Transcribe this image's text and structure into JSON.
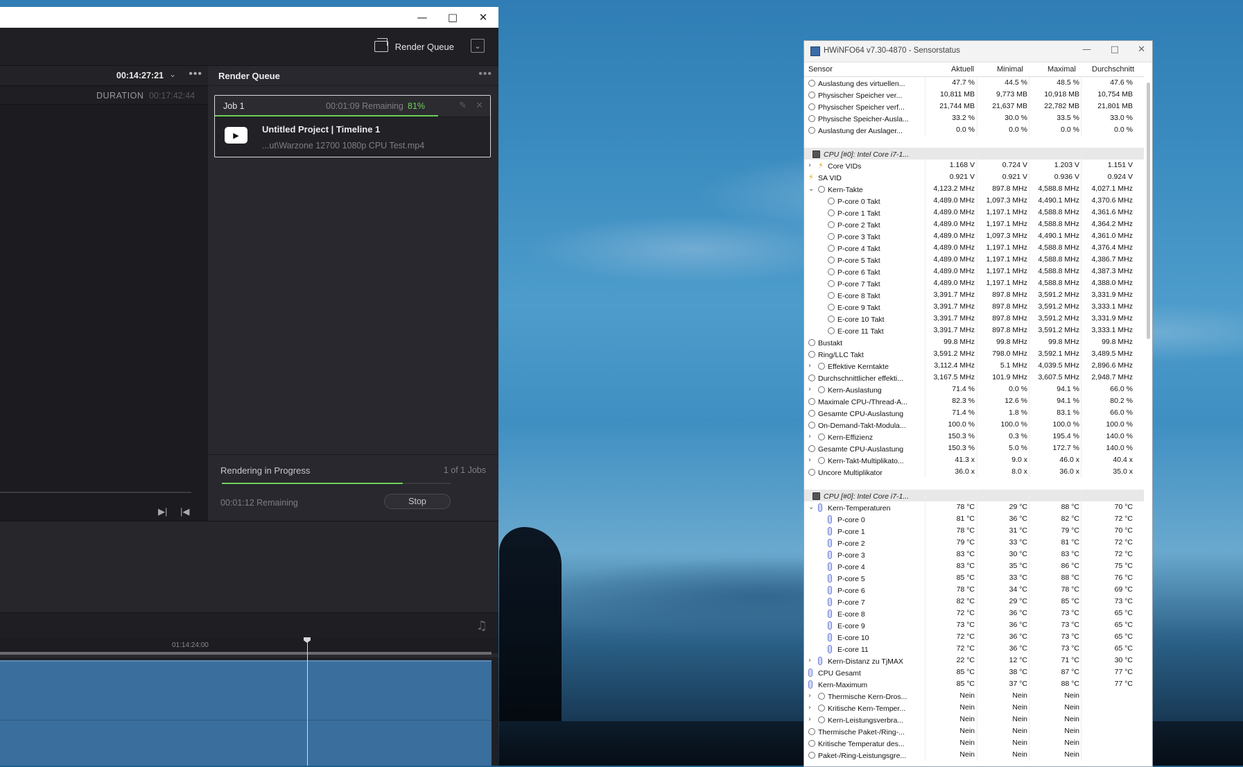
{
  "resolve": {
    "topbar": {
      "render_queue_label": "Render Queue"
    },
    "left_panel": {
      "timecode": "00:14:27:21",
      "duration_label": "DURATION",
      "duration_value": "00:17:42:44"
    },
    "render_queue": {
      "title": "Render Queue",
      "job": {
        "name": "Job 1",
        "remaining": "00:01:09 Remaining",
        "percent": "81%",
        "progress_fraction": 0.81,
        "project": "Untitled Project | Timeline 1",
        "file": "...ut\\Warzone 12700 1080p CPU Test.mp4"
      },
      "footer": {
        "status": "Rendering in Progress",
        "jobs_count": "1 of 1 Jobs",
        "remaining": "00:01:12 Remaining",
        "progress_fraction": 0.79,
        "stop_label": "Stop"
      }
    },
    "timeline": {
      "ruler_timecode": "01:14:24:00"
    }
  },
  "hwinfo": {
    "title": "HWiNFO64 v7.30-4870 - Sensorstatus",
    "columns": [
      "Sensor",
      "Aktuell",
      "Minimal",
      "Maximal",
      "Durchschnitt"
    ],
    "rows": [
      {
        "level": 1,
        "icon": "circle",
        "name": "Auslastung des virtuellen...",
        "v": [
          "47.7 %",
          "44.5 %",
          "48.5 %",
          "47.6 %"
        ]
      },
      {
        "level": 1,
        "icon": "circle",
        "name": "Physischer Speicher ver...",
        "v": [
          "10,811 MB",
          "9,773 MB",
          "10,918 MB",
          "10,754 MB"
        ]
      },
      {
        "level": 1,
        "icon": "circle",
        "name": "Physischer Speicher verf...",
        "v": [
          "21,744 MB",
          "21,637 MB",
          "22,782 MB",
          "21,801 MB"
        ]
      },
      {
        "level": 1,
        "icon": "circle",
        "name": "Physische Speicher-Ausla...",
        "v": [
          "33.2 %",
          "30.0 %",
          "33.5 %",
          "33.0 %"
        ]
      },
      {
        "level": 1,
        "icon": "circle",
        "name": "Auslastung der Auslager...",
        "v": [
          "0.0 %",
          "0.0 %",
          "0.0 %",
          "0.0 %"
        ]
      },
      {
        "blank": true
      },
      {
        "group": true,
        "expand": "open",
        "icon": "chip",
        "name": "CPU [#0]: Intel Core i7-1..."
      },
      {
        "level": 2,
        "expand": "closed",
        "icon": "bolt",
        "name": "Core VIDs",
        "v": [
          "1.168 V",
          "0.724 V",
          "1.203 V",
          "1.151 V"
        ]
      },
      {
        "level": 1,
        "icon": "bolt",
        "name": "SA VID",
        "v": [
          "0.921 V",
          "0.921 V",
          "0.936 V",
          "0.924 V"
        ]
      },
      {
        "level": 2,
        "expand": "open",
        "icon": "circle",
        "name": "Kern-Takte",
        "v": [
          "4,123.2 MHz",
          "897.8 MHz",
          "4,588.8 MHz",
          "4,027.1 MHz"
        ]
      },
      {
        "level": 3,
        "icon": "circle",
        "name": "P-core 0 Takt",
        "v": [
          "4,489.0 MHz",
          "1,097.3 MHz",
          "4,490.1 MHz",
          "4,370.6 MHz"
        ]
      },
      {
        "level": 3,
        "icon": "circle",
        "name": "P-core 1 Takt",
        "v": [
          "4,489.0 MHz",
          "1,197.1 MHz",
          "4,588.8 MHz",
          "4,361.6 MHz"
        ]
      },
      {
        "level": 3,
        "icon": "circle",
        "name": "P-core 2 Takt",
        "v": [
          "4,489.0 MHz",
          "1,197.1 MHz",
          "4,588.8 MHz",
          "4,364.2 MHz"
        ]
      },
      {
        "level": 3,
        "icon": "circle",
        "name": "P-core 3 Takt",
        "v": [
          "4,489.0 MHz",
          "1,097.3 MHz",
          "4,490.1 MHz",
          "4,361.0 MHz"
        ]
      },
      {
        "level": 3,
        "icon": "circle",
        "name": "P-core 4 Takt",
        "v": [
          "4,489.0 MHz",
          "1,197.1 MHz",
          "4,588.8 MHz",
          "4,376.4 MHz"
        ]
      },
      {
        "level": 3,
        "icon": "circle",
        "name": "P-core 5 Takt",
        "v": [
          "4,489.0 MHz",
          "1,197.1 MHz",
          "4,588.8 MHz",
          "4,386.7 MHz"
        ]
      },
      {
        "level": 3,
        "icon": "circle",
        "name": "P-core 6 Takt",
        "v": [
          "4,489.0 MHz",
          "1,197.1 MHz",
          "4,588.8 MHz",
          "4,387.3 MHz"
        ]
      },
      {
        "level": 3,
        "icon": "circle",
        "name": "P-core 7 Takt",
        "v": [
          "4,489.0 MHz",
          "1,197.1 MHz",
          "4,588.8 MHz",
          "4,388.0 MHz"
        ]
      },
      {
        "level": 3,
        "icon": "circle",
        "name": "E-core 8 Takt",
        "v": [
          "3,391.7 MHz",
          "897.8 MHz",
          "3,591.2 MHz",
          "3,331.9 MHz"
        ]
      },
      {
        "level": 3,
        "icon": "circle",
        "name": "E-core 9 Takt",
        "v": [
          "3,391.7 MHz",
          "897.8 MHz",
          "3,591.2 MHz",
          "3,333.1 MHz"
        ]
      },
      {
        "level": 3,
        "icon": "circle",
        "name": "E-core 10 Takt",
        "v": [
          "3,391.7 MHz",
          "897.8 MHz",
          "3,591.2 MHz",
          "3,331.9 MHz"
        ]
      },
      {
        "level": 3,
        "icon": "circle",
        "name": "E-core 11 Takt",
        "v": [
          "3,391.7 MHz",
          "897.8 MHz",
          "3,591.2 MHz",
          "3,333.1 MHz"
        ]
      },
      {
        "level": 1,
        "icon": "circle",
        "name": "Bustakt",
        "v": [
          "99.8 MHz",
          "99.8 MHz",
          "99.8 MHz",
          "99.8 MHz"
        ]
      },
      {
        "level": 1,
        "icon": "circle",
        "name": "Ring/LLC Takt",
        "v": [
          "3,591.2 MHz",
          "798.0 MHz",
          "3,592.1 MHz",
          "3,489.5 MHz"
        ]
      },
      {
        "level": 2,
        "expand": "closed",
        "icon": "circle",
        "name": "Effektive Kerntakte",
        "v": [
          "3,112.4 MHz",
          "5.1 MHz",
          "4,039.5 MHz",
          "2,896.6 MHz"
        ]
      },
      {
        "level": 1,
        "icon": "circle",
        "name": "Durchschnittlicher effekti...",
        "v": [
          "3,167.5 MHz",
          "101.9 MHz",
          "3,607.5 MHz",
          "2,948.7 MHz"
        ]
      },
      {
        "level": 2,
        "expand": "closed",
        "icon": "circle",
        "name": "Kern-Auslastung",
        "v": [
          "71.4 %",
          "0.0 %",
          "94.1 %",
          "66.0 %"
        ]
      },
      {
        "level": 1,
        "icon": "circle",
        "name": "Maximale CPU-/Thread-A...",
        "v": [
          "82.3 %",
          "12.6 %",
          "94.1 %",
          "80.2 %"
        ]
      },
      {
        "level": 1,
        "icon": "circle",
        "name": "Gesamte CPU-Auslastung",
        "v": [
          "71.4 %",
          "1.8 %",
          "83.1 %",
          "66.0 %"
        ]
      },
      {
        "level": 1,
        "icon": "circle",
        "name": "On-Demand-Takt-Modula...",
        "v": [
          "100.0 %",
          "100.0 %",
          "100.0 %",
          "100.0 %"
        ]
      },
      {
        "level": 2,
        "expand": "closed",
        "icon": "circle",
        "name": "Kern-Effizienz",
        "v": [
          "150.3 %",
          "0.3 %",
          "195.4 %",
          "140.0 %"
        ]
      },
      {
        "level": 1,
        "icon": "circle",
        "name": "Gesamte CPU-Auslastung",
        "v": [
          "150.3 %",
          "5.0 %",
          "172.7 %",
          "140.0 %"
        ]
      },
      {
        "level": 2,
        "expand": "closed",
        "icon": "circle",
        "name": "Kern-Takt-Multiplikato...",
        "v": [
          "41.3 x",
          "9.0 x",
          "46.0 x",
          "40.4 x"
        ]
      },
      {
        "level": 1,
        "icon": "circle",
        "name": "Uncore Multiplikator",
        "v": [
          "36.0 x",
          "8.0 x",
          "36.0 x",
          "35.0 x"
        ]
      },
      {
        "blank": true
      },
      {
        "group": true,
        "expand": "open",
        "icon": "chip",
        "name": "CPU [#0]: Intel Core i7-1..."
      },
      {
        "level": 2,
        "expand": "open",
        "icon": "therm",
        "name": "Kern-Temperaturen",
        "v": [
          "78 °C",
          "29 °C",
          "88 °C",
          "70 °C"
        ]
      },
      {
        "level": 3,
        "icon": "therm",
        "name": "P-core 0",
        "v": [
          "81 °C",
          "36 °C",
          "82 °C",
          "72 °C"
        ]
      },
      {
        "level": 3,
        "icon": "therm",
        "name": "P-core 1",
        "v": [
          "78 °C",
          "31 °C",
          "79 °C",
          "70 °C"
        ]
      },
      {
        "level": 3,
        "icon": "therm",
        "name": "P-core 2",
        "v": [
          "79 °C",
          "33 °C",
          "81 °C",
          "72 °C"
        ]
      },
      {
        "level": 3,
        "icon": "therm",
        "name": "P-core 3",
        "v": [
          "83 °C",
          "30 °C",
          "83 °C",
          "72 °C"
        ]
      },
      {
        "level": 3,
        "icon": "therm",
        "name": "P-core 4",
        "v": [
          "83 °C",
          "35 °C",
          "86 °C",
          "75 °C"
        ]
      },
      {
        "level": 3,
        "icon": "therm",
        "name": "P-core 5",
        "v": [
          "85 °C",
          "33 °C",
          "88 °C",
          "76 °C"
        ]
      },
      {
        "level": 3,
        "icon": "therm",
        "name": "P-core 6",
        "v": [
          "78 °C",
          "34 °C",
          "78 °C",
          "69 °C"
        ]
      },
      {
        "level": 3,
        "icon": "therm",
        "name": "P-core 7",
        "v": [
          "82 °C",
          "29 °C",
          "85 °C",
          "73 °C"
        ]
      },
      {
        "level": 3,
        "icon": "therm",
        "name": "E-core 8",
        "v": [
          "72 °C",
          "36 °C",
          "73 °C",
          "65 °C"
        ]
      },
      {
        "level": 3,
        "icon": "therm",
        "name": "E-core 9",
        "v": [
          "73 °C",
          "36 °C",
          "73 °C",
          "65 °C"
        ]
      },
      {
        "level": 3,
        "icon": "therm",
        "name": "E-core 10",
        "v": [
          "72 °C",
          "36 °C",
          "73 °C",
          "65 °C"
        ]
      },
      {
        "level": 3,
        "icon": "therm",
        "name": "E-core 11",
        "v": [
          "72 °C",
          "36 °C",
          "73 °C",
          "65 °C"
        ]
      },
      {
        "level": 2,
        "expand": "closed",
        "icon": "therm",
        "name": "Kern-Distanz zu TjMAX",
        "v": [
          "22 °C",
          "12 °C",
          "71 °C",
          "30 °C"
        ]
      },
      {
        "level": 1,
        "icon": "therm",
        "name": "CPU Gesamt",
        "v": [
          "85 °C",
          "38 °C",
          "87 °C",
          "77 °C"
        ]
      },
      {
        "level": 1,
        "icon": "therm",
        "name": "Kern-Maximum",
        "v": [
          "85 °C",
          "37 °C",
          "88 °C",
          "77 °C"
        ]
      },
      {
        "level": 2,
        "expand": "closed",
        "icon": "circle",
        "name": "Thermische Kern-Dros...",
        "v": [
          "Nein",
          "Nein",
          "Nein",
          ""
        ]
      },
      {
        "level": 2,
        "expand": "closed",
        "icon": "circle",
        "name": "Kritische Kern-Temper...",
        "v": [
          "Nein",
          "Nein",
          "Nein",
          ""
        ]
      },
      {
        "level": 2,
        "expand": "closed",
        "icon": "circle",
        "name": "Kern-Leistungsverbra...",
        "v": [
          "Nein",
          "Nein",
          "Nein",
          ""
        ]
      },
      {
        "level": 1,
        "icon": "circle",
        "name": "Thermische Paket-/Ring-...",
        "v": [
          "Nein",
          "Nein",
          "Nein",
          ""
        ]
      },
      {
        "level": 1,
        "icon": "circle",
        "name": "Kritische Temperatur des...",
        "v": [
          "Nein",
          "Nein",
          "Nein",
          ""
        ]
      },
      {
        "level": 1,
        "icon": "circle",
        "name": "Paket-/Ring-Leistungsgre...",
        "v": [
          "Nein",
          "Nein",
          "Nein",
          ""
        ]
      }
    ]
  }
}
